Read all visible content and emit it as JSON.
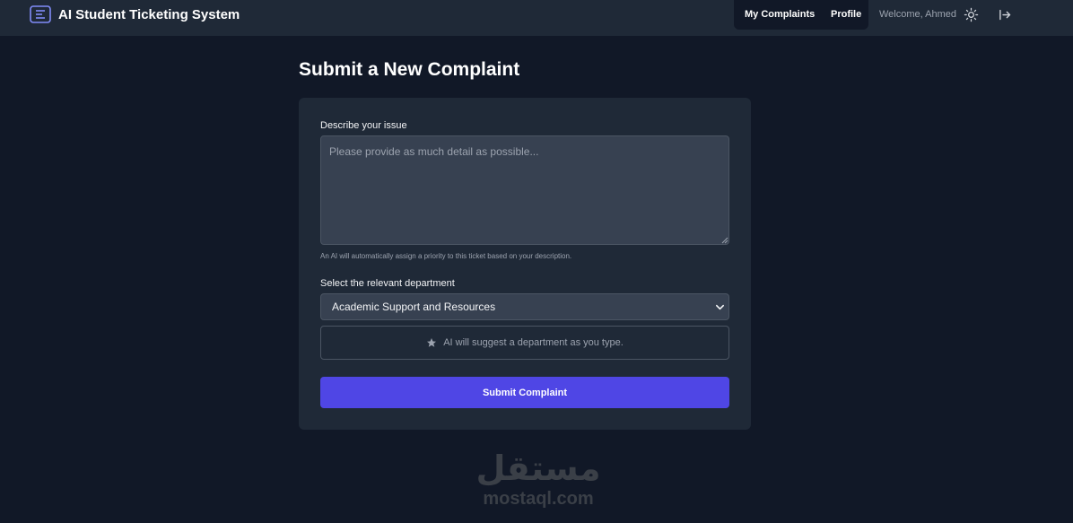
{
  "app": {
    "title": "AI Student Ticketing System",
    "logo_icon": "ticket-list-icon"
  },
  "nav": {
    "my_complaints": "My Complaints",
    "profile": "Profile",
    "welcome": "Welcome, Ahmed",
    "theme_icon": "sun-icon",
    "logout_icon": "logout-icon"
  },
  "page": {
    "title": "Submit a New Complaint"
  },
  "form": {
    "issue_label": "Describe your issue",
    "issue_placeholder": "Please provide as much detail as possible...",
    "issue_value": "",
    "ai_priority_hint": "An AI will automatically assign a priority to this ticket based on your description.",
    "department_label": "Select the relevant department",
    "department_selected": "Academic Support and Resources",
    "ai_suggest_text": "AI will suggest a department as you type.",
    "submit_label": "Submit Complaint"
  },
  "watermark": {
    "arabic": "مستقل",
    "latin": "mostaql.com"
  },
  "colors": {
    "background": "#111827",
    "surface": "#1f2937",
    "input": "#374151",
    "accent": "#4f46e5"
  }
}
